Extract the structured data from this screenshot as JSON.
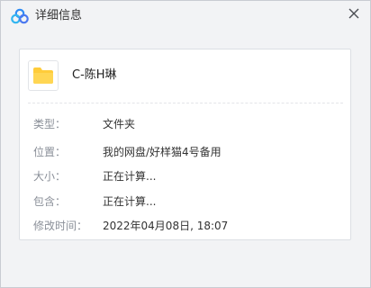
{
  "window": {
    "title": "详细信息",
    "title_icon": "baidu-netdisk-logo",
    "close_icon": "close-icon"
  },
  "file": {
    "icon": "folder-icon",
    "name": "C-陈H琳"
  },
  "details": [
    {
      "label": "类型：",
      "value": "文件夹"
    },
    {
      "label": "位置：",
      "value": "我的网盘/好样猫4号备用"
    },
    {
      "label": "大小：",
      "value": "正在计算..."
    },
    {
      "label": "包含：",
      "value": "正在计算..."
    },
    {
      "label": "修改时间：",
      "value": "2022年04月08日, 18:07"
    }
  ],
  "colors": {
    "window_bg": "#f2f3f5",
    "panel_bg": "#ffffff",
    "label_text": "#8a8f98",
    "value_text": "#333333",
    "folder_yellow": "#ffcc3a",
    "logo_blue": "#2f8cf5"
  }
}
